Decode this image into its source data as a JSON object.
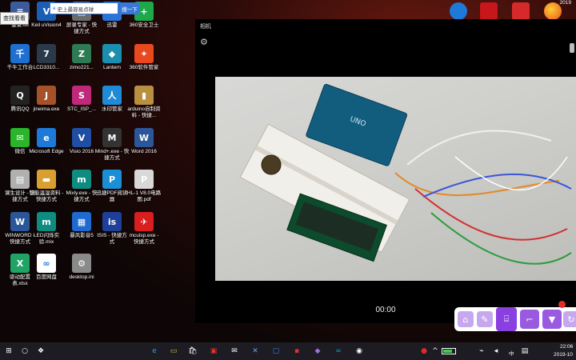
{
  "tooltip": "查找看看",
  "desktop_icons": [
    {
      "label": "重录.txt",
      "glyph": "≡",
      "color": "#3c5b9a"
    },
    {
      "label": "Keil uVision4",
      "glyph": "V",
      "color": "#1b5fb5"
    },
    {
      "label": "屏录专家 - 快捷方式",
      "glyph": "▣",
      "color": "#6b6b6b"
    },
    {
      "label": "迅雷",
      "glyph": "✕",
      "color": "#2a74d8"
    },
    {
      "label": "360安全卫士",
      "glyph": "+",
      "color": "#1da84a"
    },
    {
      "label": "千牛工作台",
      "glyph": "千",
      "color": "#1d6fd0"
    },
    {
      "label": "LCD3310...",
      "glyph": "7",
      "color": "#2b3a4a"
    },
    {
      "label": "zimo221...",
      "glyph": "Z",
      "color": "#2d7a54"
    },
    {
      "label": "Lantern",
      "glyph": "◆",
      "color": "#1b8fb0"
    },
    {
      "label": "360软件管家",
      "glyph": "✦",
      "color": "#e8491f"
    },
    {
      "label": "腾讯QQ",
      "glyph": "Q",
      "color": "#222222"
    },
    {
      "label": "jineima.exe",
      "glyph": "J",
      "color": "#a5522a"
    },
    {
      "label": "STC_ISP_...",
      "glyph": "S",
      "color": "#c0297a"
    },
    {
      "label": "水印管家",
      "glyph": "人",
      "color": "#1f8bd6"
    },
    {
      "label": "arduino自制资料 - 快捷...",
      "glyph": "▮",
      "color": "#b89040"
    },
    {
      "label": "微信",
      "glyph": "✉",
      "color": "#2ab52a"
    },
    {
      "label": "Microsoft Edge",
      "glyph": "e",
      "color": "#1d7ad8"
    },
    {
      "label": "Visio 2016",
      "glyph": "V",
      "color": "#1f4ea3"
    },
    {
      "label": "Mind+.exe - 快捷方式",
      "glyph": "M",
      "color": "#333333"
    },
    {
      "label": "Word 2016",
      "glyph": "W",
      "color": "#2b579a"
    },
    {
      "label": "课生设计 - 快捷方式",
      "glyph": "▤",
      "color": "#b0b0b0"
    },
    {
      "label": "智能温湿资料 - 快捷方式",
      "glyph": "▬",
      "color": "#d8a030"
    },
    {
      "label": "Mixly.exe - 快捷方式",
      "glyph": "m",
      "color": "#0f8c80"
    },
    {
      "label": "迅捷PDF阅读器",
      "glyph": "P",
      "color": "#1a8fd6"
    },
    {
      "label": "HL-1 V8.0电路图.pdf",
      "glyph": "P",
      "color": "#d8d8d8"
    },
    {
      "label": "WINWORD - 快捷方式",
      "glyph": "W",
      "color": "#2b579a"
    },
    {
      "label": "LED闪烁实验.mix",
      "glyph": "m",
      "color": "#0f8c80"
    },
    {
      "label": "暴风影音5",
      "glyph": "▦",
      "color": "#1f6ad0"
    },
    {
      "label": "ISIS - 快捷方式",
      "glyph": "is",
      "color": "#1e3f9a"
    },
    {
      "label": "mcuisp.exe - 快捷方式",
      "glyph": "✈",
      "color": "#d81e1e"
    },
    {
      "label": "驱动配置表.xlsx",
      "glyph": "X",
      "color": "#21a366"
    },
    {
      "label": "百度网盘",
      "glyph": "∞",
      "color": "#ffffff"
    },
    {
      "label": "desktop.ini",
      "glyph": "⚙",
      "color": "#8a8a8a"
    }
  ],
  "top_right": {
    "date_badge": "2019"
  },
  "camera": {
    "title": "相机",
    "gear_icon": "gear-icon",
    "timer": "00:00"
  },
  "taskbar": {
    "search_placeholder": "史上最容易点球",
    "search_button": "搜一下",
    "battery_percent": 80,
    "ime": "中",
    "time": "22:06",
    "date": "2019-10"
  },
  "colors": {
    "taskbar": "#1c1c22",
    "accent": "#3a78d8",
    "float_bar_accent": "#8a3fe0"
  }
}
